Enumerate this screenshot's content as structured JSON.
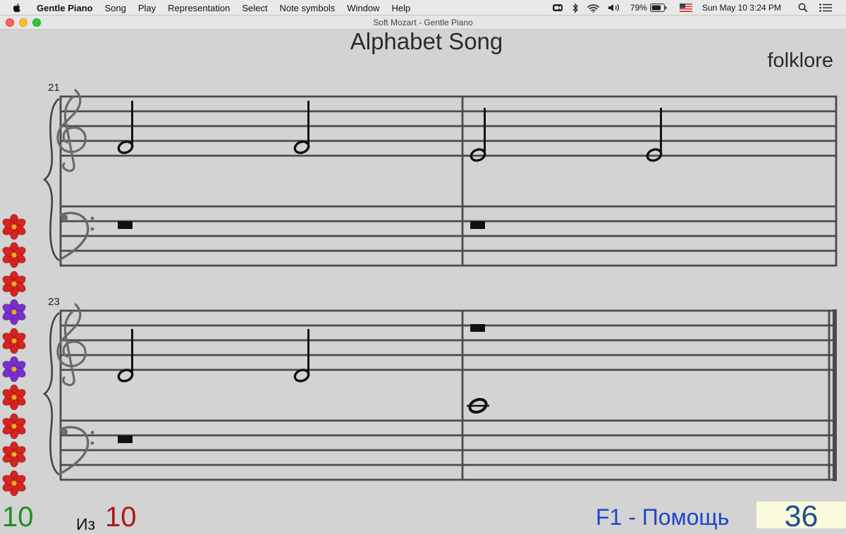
{
  "menubar": {
    "items": [
      "Gentle Piano",
      "Song",
      "Play",
      "Representation",
      "Select",
      "Note symbols",
      "Window",
      "Help"
    ],
    "battery": "79%",
    "clock": "Sun May 10  3:24 PM"
  },
  "window": {
    "title": "Soft Mozart - Gentle Piano"
  },
  "score": {
    "title": "Alphabet Song",
    "composer": "folklore",
    "systems": [
      {
        "bar_number": "21"
      },
      {
        "bar_number": "23"
      }
    ]
  },
  "flowers": [
    "red",
    "red",
    "red",
    "purple",
    "red",
    "purple",
    "red",
    "red",
    "red",
    "red"
  ],
  "colors": {
    "flower_red": "#d8231e",
    "flower_purple": "#7b2fd0"
  },
  "status": {
    "current": "10",
    "of_label": "Из",
    "total": "10",
    "help": "F1 - Помощь",
    "note_count": "36"
  }
}
